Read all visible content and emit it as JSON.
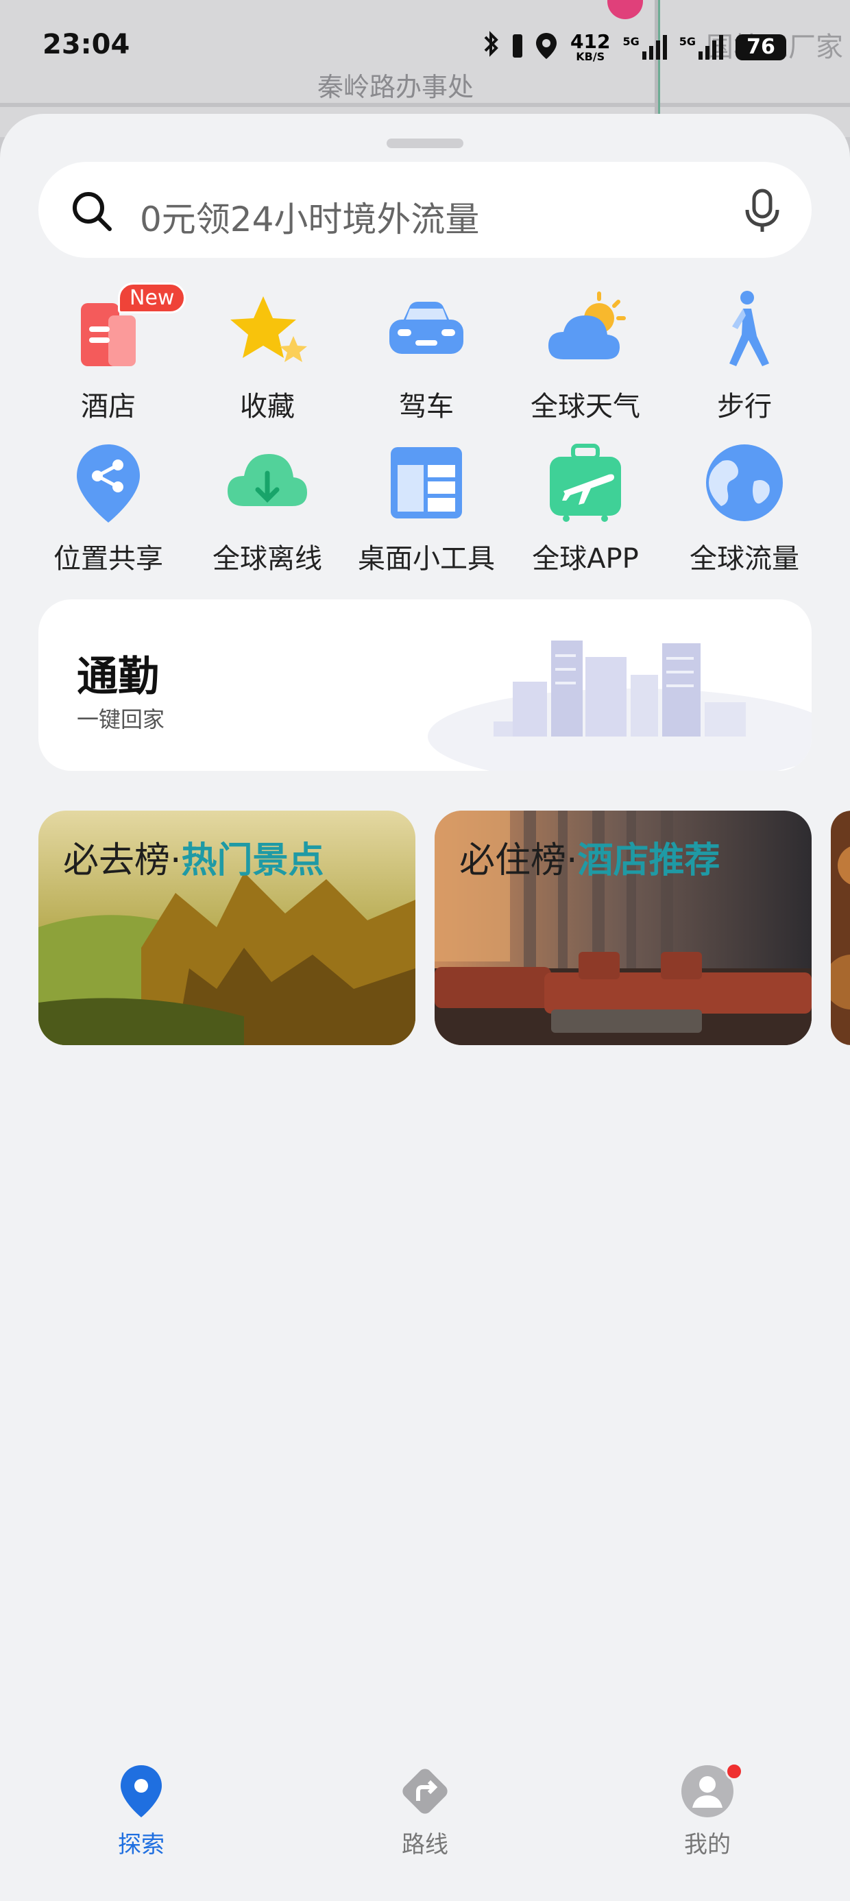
{
  "status_bar": {
    "time": "23:04",
    "net_speed": "412",
    "net_speed_unit": "KB/S",
    "signal_1_label": "5G",
    "signal_2_label": "5G",
    "battery": "76",
    "icons": [
      "bluetooth-icon",
      "location-icon",
      "signal-icon",
      "signal-icon",
      "battery-icon"
    ]
  },
  "map": {
    "label_main": "秦岭路办事处",
    "label_corner": "国棉三厂家"
  },
  "search": {
    "placeholder": "0元领24小时境外流量",
    "icon": "search-icon",
    "voice_icon": "microphone-icon"
  },
  "shortcuts": [
    {
      "label": "酒店",
      "icon": "hotel-icon",
      "badge": "New"
    },
    {
      "label": "收藏",
      "icon": "star-icon"
    },
    {
      "label": "驾车",
      "icon": "car-icon"
    },
    {
      "label": "全球天气",
      "icon": "weather-icon"
    },
    {
      "label": "步行",
      "icon": "walking-icon"
    },
    {
      "label": "位置共享",
      "icon": "location-share-icon"
    },
    {
      "label": "全球离线",
      "icon": "offline-cloud-icon"
    },
    {
      "label": "桌面小工具",
      "icon": "widget-icon"
    },
    {
      "label": "全球APP",
      "icon": "travel-app-icon"
    },
    {
      "label": "全球流量",
      "icon": "globe-icon"
    }
  ],
  "commute": {
    "title": "通勤",
    "subtitle": "一键回家"
  },
  "rank_cards": [
    {
      "prefix": "必去榜",
      "sep": "·",
      "highlight": "热门景点"
    },
    {
      "prefix": "必住榜",
      "sep": "·",
      "highlight": "酒店推荐"
    }
  ],
  "colors": {
    "accent": "#1f6fe0",
    "highlight_teal": "#1f9aa5",
    "badge_red": "#ef4338"
  },
  "bottom_nav": [
    {
      "label": "探索",
      "icon": "map-pin-icon",
      "active": true
    },
    {
      "label": "路线",
      "icon": "route-icon",
      "active": false
    },
    {
      "label": "我的",
      "icon": "profile-icon",
      "active": false
    }
  ]
}
